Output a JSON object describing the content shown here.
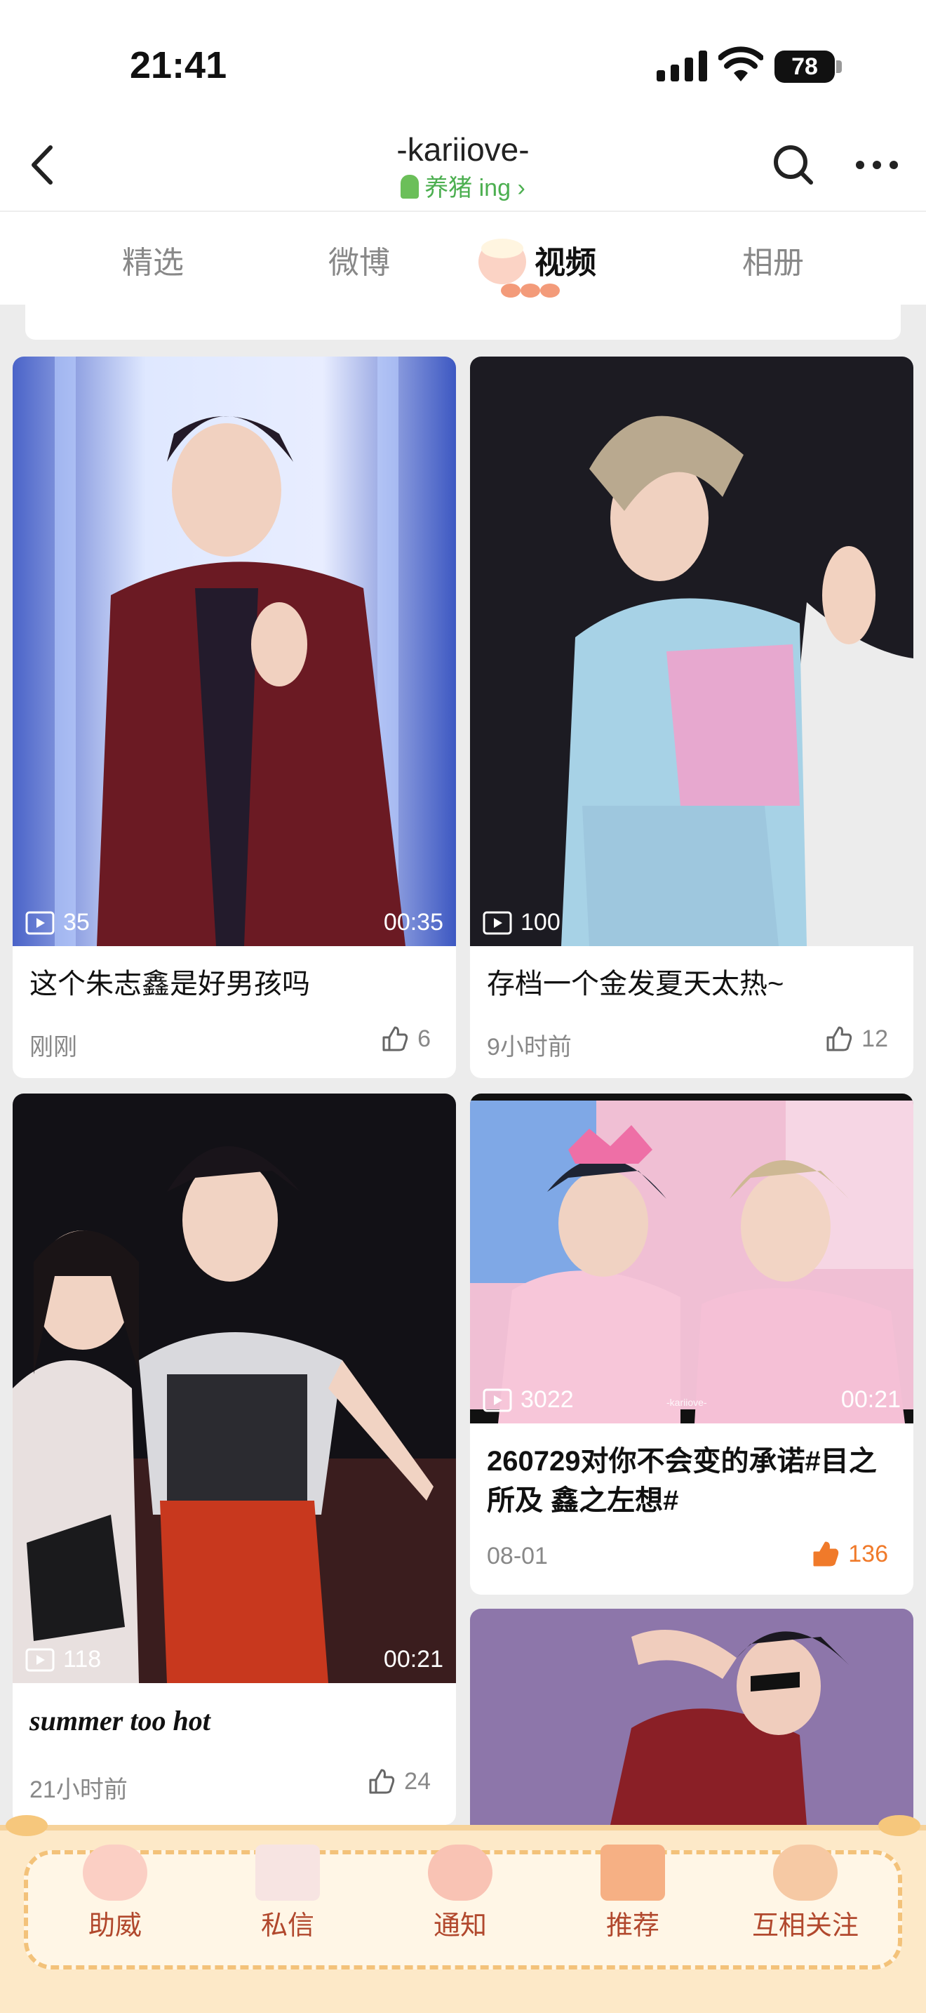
{
  "status": {
    "time": "21:41",
    "battery": "78"
  },
  "header": {
    "username": "-kariiove-",
    "subtitle": "养猪 ing",
    "back_icon": "chevron-left-icon",
    "search_icon": "search-icon",
    "more_icon": "more-horizontal-icon"
  },
  "tabs": [
    {
      "label": "精选",
      "active": false
    },
    {
      "label": "微博",
      "active": false
    },
    {
      "label": "视频",
      "active": true
    },
    {
      "label": "相册",
      "active": false
    }
  ],
  "videos": [
    {
      "title": "这个朱志鑫是好男孩吗",
      "plays": "35",
      "duration": "00:35",
      "time": "刚刚",
      "likes": "6",
      "liked": false
    },
    {
      "title": "存档一个金发夏天太热~",
      "plays": "100",
      "duration": "",
      "time": "9小时前",
      "likes": "12",
      "liked": false
    },
    {
      "title": "summer too hot",
      "plays": "118",
      "duration": "00:21",
      "time": "21小时前",
      "likes": "24",
      "liked": false
    },
    {
      "title": "260729对你不会变的承诺#目之所及 鑫之左想#",
      "plays": "3022",
      "duration": "00:21",
      "time": "08-01",
      "likes": "136",
      "liked": true,
      "watermark": "-kariiove-"
    }
  ],
  "bottom_nav": [
    {
      "label": "助威"
    },
    {
      "label": "私信"
    },
    {
      "label": "通知"
    },
    {
      "label": "推荐"
    },
    {
      "label": "互相关注"
    }
  ],
  "colors": {
    "accent_green": "#4caf50",
    "like_active": "#f07a2a",
    "bottom_label": "#b1482d"
  }
}
